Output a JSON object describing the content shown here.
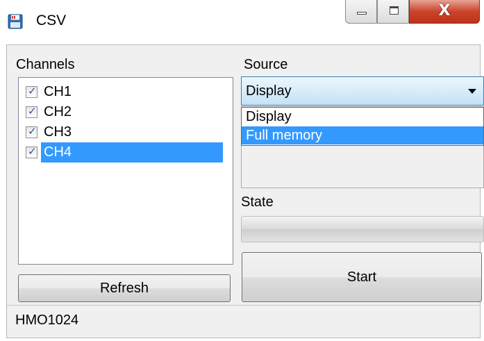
{
  "window": {
    "title": "CSV",
    "icon": "floppy-disk-icon",
    "controls": {
      "minimize_icon": "minimize-icon",
      "maximize_icon": "maximize-icon",
      "close_label": "X"
    }
  },
  "channels": {
    "label": "Channels",
    "items": [
      {
        "label": "CH1",
        "checked": true,
        "selected": false
      },
      {
        "label": "CH2",
        "checked": true,
        "selected": false
      },
      {
        "label": "CH3",
        "checked": true,
        "selected": false
      },
      {
        "label": "CH4",
        "checked": true,
        "selected": true
      }
    ],
    "refresh_label": "Refresh"
  },
  "source": {
    "label": "Source",
    "value": "Display",
    "options": [
      {
        "label": "Display",
        "highlighted": false
      },
      {
        "label": "Full memory",
        "highlighted": true
      }
    ]
  },
  "state": {
    "label": "State",
    "progress": 0
  },
  "start_label": "Start",
  "statusbar": {
    "text": "HMO1024"
  },
  "colors": {
    "selection": "#3399ff",
    "close_button": "#c9442b",
    "client_bg": "#f0f0f0",
    "checkmark": "#3a4f9a"
  }
}
